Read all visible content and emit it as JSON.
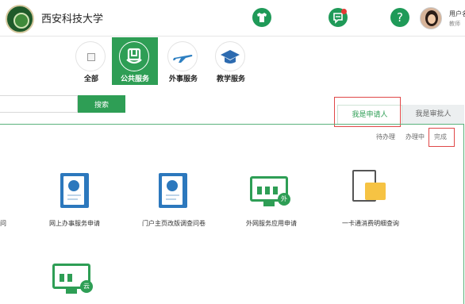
{
  "header": {
    "school_name": "西安科技大学",
    "icons": [
      "shirt-icon",
      "message-icon",
      "help-icon"
    ],
    "help_symbol": "?",
    "user_name": "用户名",
    "user_role": "教师"
  },
  "categories": [
    {
      "label": "全部",
      "icon": "broken-image-icon",
      "active": false
    },
    {
      "label": "公共服务",
      "icon": "public-service-icon",
      "active": true
    },
    {
      "label": "外事服务",
      "icon": "airplane-icon",
      "active": false
    },
    {
      "label": "教学服务",
      "icon": "graduation-cap-icon",
      "active": false
    }
  ],
  "search": {
    "placeholder": "",
    "button": "搜索"
  },
  "roles": {
    "applicant": "我是申请人",
    "approver": "我是审批人"
  },
  "status_filters": {
    "todo": "待办理",
    "doing": "办理中",
    "done": "完成"
  },
  "services": [
    {
      "label": "网上办事服务申请",
      "icon": "document-seal-icon"
    },
    {
      "label": "门户主页改版调查问卷",
      "icon": "document-seal-icon"
    },
    {
      "label": "外网服务应用申请",
      "icon": "external-network-icon",
      "badge": "外"
    },
    {
      "label": "一卡通消费明细查询",
      "icon": "card-query-icon"
    },
    {
      "label": "",
      "icon": "cloud-service-icon",
      "badge": "云"
    }
  ],
  "colors": {
    "brand_green": "#2e9e55",
    "highlight_red": "#e04848",
    "doc_blue": "#2c78bd"
  }
}
